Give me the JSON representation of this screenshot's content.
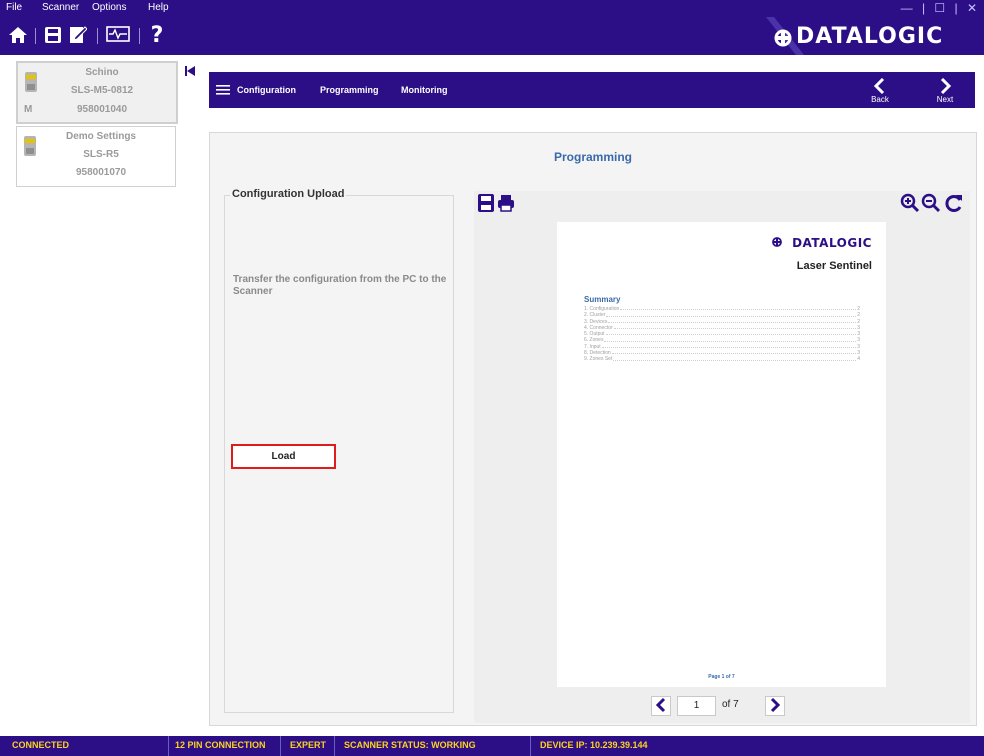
{
  "menu": {
    "file": "File",
    "scanner": "Scanner",
    "options": "Options",
    "help": "Help"
  },
  "window_controls": "— | ☐ | ✕",
  "toolbar": {
    "help_glyph": "?"
  },
  "brand": {
    "logo": "DATALOGIC",
    "color": "#2c0f86"
  },
  "devices": [
    {
      "name": "Schino",
      "model": "SLS-M5-0812",
      "role": "M",
      "serial": "958001040"
    },
    {
      "name": "Demo Settings",
      "model": "SLS-R5",
      "serial": "958001070"
    }
  ],
  "nav": {
    "items": [
      "Configuration",
      "Programming",
      "Monitoring"
    ],
    "back": "Back",
    "next": "Next"
  },
  "panel": {
    "title": "Programming",
    "upload_legend": "Configuration Upload",
    "upload_desc": "Transfer the configuration from the PC to the Scanner",
    "load": "Load"
  },
  "preview": {
    "logo": "DATALOGIC",
    "subtitle": "Laser Sentinel",
    "summary_title": "Summary",
    "toc": [
      {
        "t": "1. Configuration",
        "p": "2"
      },
      {
        "t": "2. Cluster",
        "p": "2"
      },
      {
        "t": "3. Devices",
        "p": "2"
      },
      {
        "t": "4. Connector",
        "p": "3"
      },
      {
        "t": "5. Output",
        "p": "3"
      },
      {
        "t": "6. Zones",
        "p": "3"
      },
      {
        "t": "7. Input",
        "p": "3"
      },
      {
        "t": "8. Detection",
        "p": "3"
      },
      {
        "t": "9. Zones Set",
        "p": "4"
      }
    ],
    "footer": "Page 1 of 7",
    "page_value": "1",
    "page_of": "of 7"
  },
  "status": {
    "connected": "CONNECTED",
    "pin": "12 PIN CONNECTION",
    "mode": "EXPERT",
    "scanner": "SCANNER STATUS: WORKING",
    "ip": "DEVICE IP: 10.239.39.144"
  },
  "colors": {
    "status_text": "#ffd21f",
    "title_blue": "#3a6aa8",
    "highlight": "#e01b1b"
  }
}
